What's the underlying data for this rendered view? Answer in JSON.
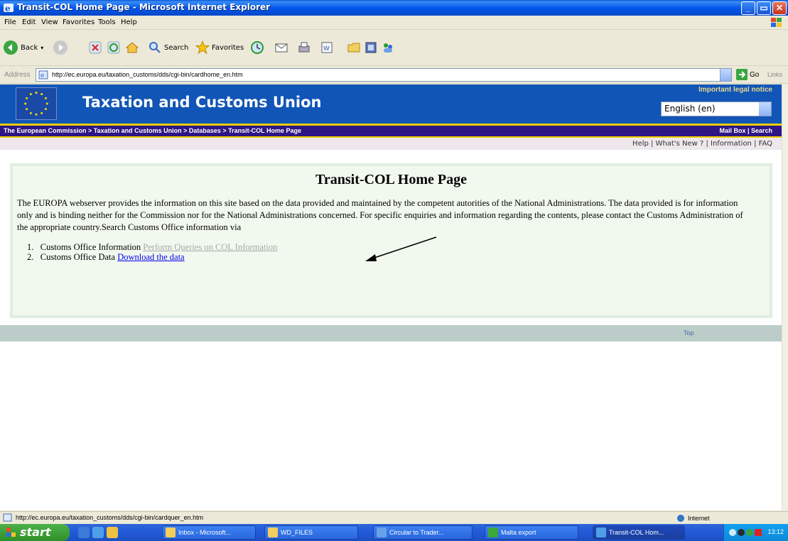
{
  "window": {
    "title": "Transit-COL Home Page - Microsoft Internet Explorer",
    "minimize_label": "_",
    "maximize_label": "▭",
    "close_label": "✕"
  },
  "menu": [
    "File",
    "Edit",
    "View",
    "Favorites",
    "Tools",
    "Help"
  ],
  "toolbar": {
    "back_label": "Back",
    "search_label": "Search",
    "favorites_label": "Favorites"
  },
  "address": {
    "label": "Address",
    "url": "http://ec.europa.eu/taxation_customs/dds/cgi-bin/cardhome_en.htm",
    "go_label": "Go",
    "links_label": "Links"
  },
  "site": {
    "title": "Taxation and Customs Union",
    "legal_notice": "Important legal notice",
    "language": "English (en)",
    "breadcrumb": "The European Commission > Taxation and Customs Union > Databases > Transit-COL Home Page",
    "mailbox_search": "Mail Box | Search",
    "help_links": "Help | What's New ? | Information | FAQ",
    "top_link": "Top"
  },
  "page": {
    "heading": "Transit-COL Home Page",
    "intro": "The EUROPA webserver provides the information on this site based on the data provided and maintained by the competent autorities of the National Administrations. The data provided is for information only and is binding neither for the Commission nor for the National Administrations concerned. For specific enquiries and information regarding the contents, please contact the Customs Administration of the appropriate country.Search Customs Office information via",
    "items": [
      {
        "num": "1.",
        "text": "Customs Office Information",
        "link": "Perform Queries on COL Information"
      },
      {
        "num": "2.",
        "text": "Customs Office Data",
        "link": "Download the data"
      }
    ]
  },
  "status": {
    "url": "http://ec.europa.eu/taxation_customs/dds/cgi-bin/cardquer_en.htm",
    "zone": "Internet"
  },
  "taskbar": {
    "start_label": "start",
    "tasks": [
      "Inbox - Microsoft...",
      "WD_FILES",
      "Circular to Trader...",
      "Malta export",
      "Transit-COL Hom..."
    ],
    "clock": "13:12"
  },
  "colors": {
    "eu_blue": "#1155b6",
    "breadcrumb_bg": "#2e1684",
    "gold": "#f0d000",
    "panel_bg": "#f1f8ee"
  }
}
